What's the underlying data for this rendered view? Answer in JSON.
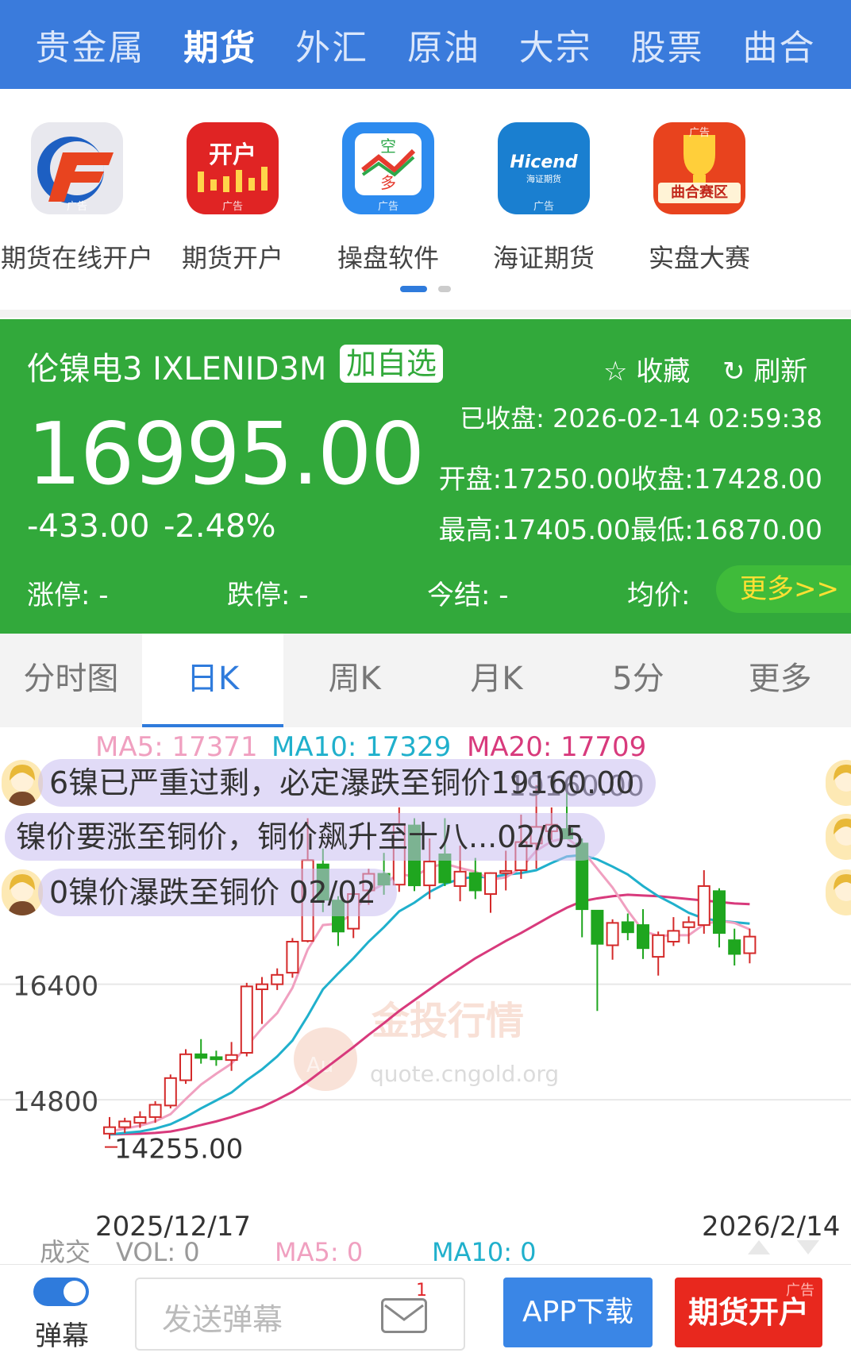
{
  "nav": {
    "items": [
      "贵金属",
      "期货",
      "外汇",
      "原油",
      "大宗",
      "股票",
      "曲合"
    ],
    "active_index": 1
  },
  "ads": {
    "items": [
      {
        "label": "期货在线开户",
        "icon": "brand-f-logo-icon",
        "tag": "广告",
        "color": "#e8e8ee"
      },
      {
        "label": "期货开户",
        "icon": "open-account-icon",
        "tag": "广告",
        "color": "#e02424",
        "icon_text": "开户"
      },
      {
        "label": "操盘软件",
        "icon": "trading-software-icon",
        "tag": "广告",
        "color": "#2d8bef",
        "icon_text_top": "空",
        "icon_text_bottom": "多"
      },
      {
        "label": "海证期货",
        "icon": "hicend-logo-icon",
        "tag": "广告",
        "color": "#1a7fd0",
        "icon_text": "Hicend",
        "icon_sub": "海证期货"
      },
      {
        "label": "实盘大赛",
        "icon": "trophy-icon",
        "tag": "广告",
        "color": "#e8431e",
        "icon_text": "曲合赛区"
      }
    ],
    "page_count": 2,
    "active_page": 0
  },
  "quote": {
    "name": "伦镍电3 IXLENID3M",
    "add_watch": "加自选",
    "favorite": "收藏",
    "refresh": "刷新",
    "price": "16995.00",
    "change": "-433.00",
    "change_pct": "-2.48%",
    "closed_time": "已收盘: 2026-02-14 02:59:38",
    "open_close": "开盘:17250.00收盘:17428.00",
    "high_low": "最高:17405.00最低:16870.00",
    "limit_up": "涨停: -",
    "limit_down": "跌停: -",
    "settle": "今结: -",
    "avg": "均价:",
    "more": "更多>>",
    "bg_color": "#32a93b"
  },
  "tabs": {
    "items": [
      "分时图",
      "日K",
      "周K",
      "月K",
      "5分",
      "更多"
    ],
    "active_index": 1
  },
  "chart_data": {
    "type": "candlestick",
    "ma_labels": {
      "ma5": "MA5: 17371",
      "ma10": "MA10: 17329",
      "ma20": "MA20: 17709"
    },
    "y_ticks": [
      16400,
      14800
    ],
    "y_tick_labels": [
      "16400",
      "14800"
    ],
    "ylim": [
      13800,
      19300
    ],
    "x_start_label": "2025/12/17",
    "x_end_label": "2026/2/14",
    "min_label": "14255.00",
    "max_label": "19160.00",
    "watermark": {
      "brand": "金投行情",
      "url": "quote.cngold.org",
      "logo_text": "Au"
    },
    "colors": {
      "up": "#d42a2a",
      "down": "#1fa61f",
      "ma5": "#f0a0c0",
      "ma10": "#20b0cc",
      "ma20": "#d83a7c"
    },
    "candles": [
      {
        "o": 14330,
        "h": 14560,
        "l": 14255,
        "c": 14420
      },
      {
        "o": 14420,
        "h": 14550,
        "l": 14340,
        "c": 14500
      },
      {
        "o": 14480,
        "h": 14640,
        "l": 14410,
        "c": 14560
      },
      {
        "o": 14560,
        "h": 14780,
        "l": 14480,
        "c": 14730
      },
      {
        "o": 14720,
        "h": 15150,
        "l": 14680,
        "c": 15100
      },
      {
        "o": 15070,
        "h": 15500,
        "l": 15020,
        "c": 15430
      },
      {
        "o": 15430,
        "h": 15640,
        "l": 15300,
        "c": 15380
      },
      {
        "o": 15390,
        "h": 15480,
        "l": 15270,
        "c": 15360
      },
      {
        "o": 15350,
        "h": 15600,
        "l": 15200,
        "c": 15420
      },
      {
        "o": 15450,
        "h": 16420,
        "l": 15400,
        "c": 16370
      },
      {
        "o": 16330,
        "h": 16500,
        "l": 15850,
        "c": 16400
      },
      {
        "o": 16400,
        "h": 16620,
        "l": 16320,
        "c": 16530
      },
      {
        "o": 16560,
        "h": 17040,
        "l": 16490,
        "c": 16990
      },
      {
        "o": 17000,
        "h": 18700,
        "l": 16980,
        "c": 18120
      },
      {
        "o": 18060,
        "h": 18280,
        "l": 17400,
        "c": 17570
      },
      {
        "o": 17560,
        "h": 17620,
        "l": 16930,
        "c": 17130
      },
      {
        "o": 17170,
        "h": 17750,
        "l": 17040,
        "c": 17650
      },
      {
        "o": 17700,
        "h": 18000,
        "l": 17500,
        "c": 17930
      },
      {
        "o": 17930,
        "h": 18220,
        "l": 17640,
        "c": 17780
      },
      {
        "o": 17780,
        "h": 18850,
        "l": 17680,
        "c": 18620
      },
      {
        "o": 18600,
        "h": 18700,
        "l": 17690,
        "c": 17770
      },
      {
        "o": 17770,
        "h": 18420,
        "l": 17580,
        "c": 18100
      },
      {
        "o": 18200,
        "h": 18700,
        "l": 17760,
        "c": 17810
      },
      {
        "o": 17760,
        "h": 18320,
        "l": 17550,
        "c": 17960
      },
      {
        "o": 17940,
        "h": 18150,
        "l": 17580,
        "c": 17700
      },
      {
        "o": 17650,
        "h": 17950,
        "l": 17390,
        "c": 17940
      },
      {
        "o": 17940,
        "h": 18250,
        "l": 17700,
        "c": 17970
      },
      {
        "o": 17980,
        "h": 18750,
        "l": 17860,
        "c": 18370
      },
      {
        "o": 18350,
        "h": 19160,
        "l": 18000,
        "c": 18580
      },
      {
        "o": 18520,
        "h": 18850,
        "l": 18400,
        "c": 18610
      },
      {
        "o": 18550,
        "h": 19120,
        "l": 18450,
        "c": 18420
      },
      {
        "o": 18350,
        "h": 18420,
        "l": 17050,
        "c": 17440
      },
      {
        "o": 17420,
        "h": 17430,
        "l": 16030,
        "c": 16960
      },
      {
        "o": 16940,
        "h": 17300,
        "l": 16740,
        "c": 17250
      },
      {
        "o": 17260,
        "h": 17380,
        "l": 17010,
        "c": 17120
      },
      {
        "o": 17220,
        "h": 17440,
        "l": 16750,
        "c": 16900
      },
      {
        "o": 16780,
        "h": 17130,
        "l": 16520,
        "c": 17080
      },
      {
        "o": 16990,
        "h": 17330,
        "l": 16930,
        "c": 17140
      },
      {
        "o": 17190,
        "h": 17340,
        "l": 16960,
        "c": 17260
      },
      {
        "o": 17220,
        "h": 17980,
        "l": 17100,
        "c": 17760
      },
      {
        "o": 17690,
        "h": 17730,
        "l": 16910,
        "c": 17110
      },
      {
        "o": 17010,
        "h": 17170,
        "l": 16660,
        "c": 16820
      },
      {
        "o": 16830,
        "h": 17170,
        "l": 16690,
        "c": 17060
      }
    ],
    "ma5": [
      14360,
      14400,
      14440,
      14500,
      14600,
      14810,
      15010,
      15160,
      15300,
      15540,
      15790,
      16000,
      16350,
      16880,
      17220,
      17240,
      17390,
      17680,
      17790,
      17930,
      17890,
      18020,
      18070,
      18010,
      17960,
      17850,
      17880,
      18010,
      18250,
      18380,
      18430,
      18260,
      18000,
      17740,
      17420,
      17140,
      17070,
      17080,
      17080,
      17230,
      17280,
      17250,
      17160
    ],
    "ma10": [
      14320,
      14340,
      14360,
      14400,
      14460,
      14560,
      14680,
      14790,
      14900,
      15070,
      15220,
      15400,
      15620,
      15960,
      16330,
      16550,
      16760,
      16990,
      17190,
      17410,
      17530,
      17680,
      17790,
      17860,
      17890,
      17880,
      17920,
      17940,
      17980,
      18080,
      18170,
      18190,
      18130,
      18030,
      17920,
      17760,
      17620,
      17510,
      17390,
      17310,
      17280,
      17260,
      17240
    ],
    "ma20": [
      14320,
      14325,
      14330,
      14340,
      14360,
      14400,
      14450,
      14500,
      14560,
      14630,
      14700,
      14800,
      14910,
      15050,
      15210,
      15370,
      15530,
      15700,
      15860,
      16030,
      16180,
      16330,
      16480,
      16620,
      16760,
      16880,
      17000,
      17110,
      17230,
      17350,
      17460,
      17550,
      17590,
      17620,
      17640,
      17630,
      17620,
      17600,
      17580,
      17560,
      17540,
      17520,
      17510
    ]
  },
  "danmaku": [
    {
      "text": "6镍已严重过剩，必定瀑跌至铜价19160.00",
      "avatar": "user-avatar-icon"
    },
    {
      "text": "镍价要涨至铜价，铜价飙升至十八...02/05",
      "avatar": "user-avatar-icon"
    },
    {
      "text": "0镍价瀑跌至铜价 02/02",
      "avatar": "user-avatar-icon"
    }
  ],
  "volume": {
    "label": "成交",
    "vol": "VOL: 0",
    "ma5": "MA5: 0",
    "ma10": "MA10: 0"
  },
  "bottom": {
    "toggle_label": "弹幕",
    "toggle_on": true,
    "input_placeholder": "发送弹幕",
    "msg_badge": "1",
    "app_download": "APP下载",
    "open_account": "期货开户",
    "open_account_tag": "广告"
  }
}
